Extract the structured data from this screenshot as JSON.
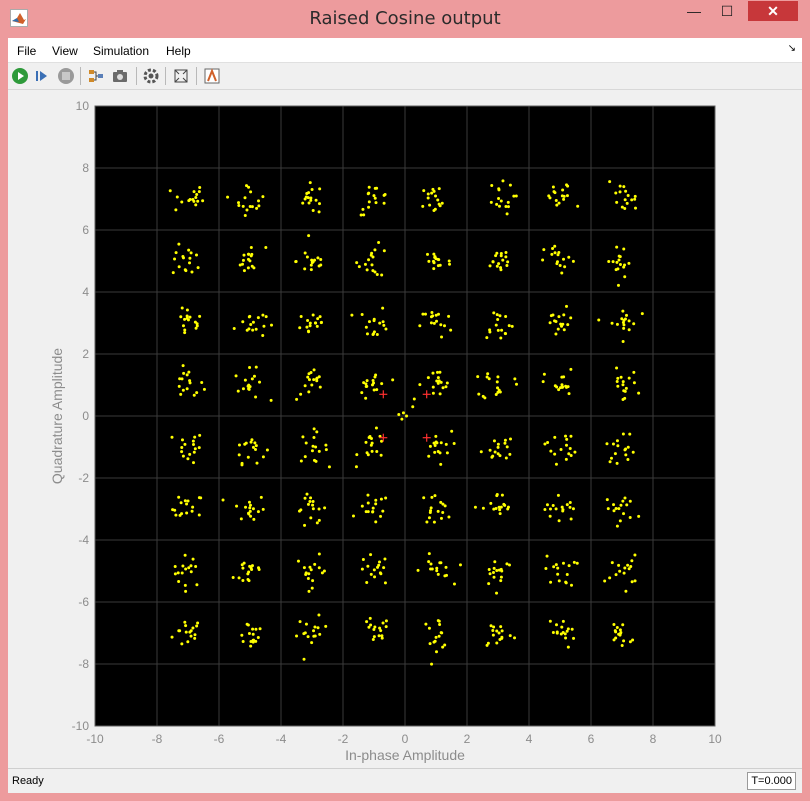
{
  "window": {
    "title": "Raised Cosine output",
    "minimize_glyph": "—",
    "maximize_glyph": "☐",
    "close_glyph": "✕"
  },
  "menu": {
    "items": [
      "File",
      "View",
      "Simulation",
      "Help"
    ],
    "overflow_glyph": "↘"
  },
  "toolbar": {
    "icons": [
      "run-icon",
      "step-forward-icon",
      "stop-icon",
      "signal-selector-icon",
      "snapshot-icon",
      "settings-icon",
      "zoom-fit-icon",
      "highlight-block-icon"
    ]
  },
  "status": {
    "left": "Ready",
    "right": "T=0.000"
  },
  "colors": {
    "plot_background": "#000000",
    "points": "#ffff00",
    "reference_markers": "#ff3030",
    "axis_text": "#8c8c8c",
    "grid": "#3a3a3a"
  },
  "chart_data": {
    "type": "scatter",
    "title": "",
    "xlabel": "In-phase Amplitude",
    "ylabel": "Quadrature Amplitude",
    "xlim": [
      -10,
      10
    ],
    "ylim": [
      -10,
      10
    ],
    "xticks": [
      -10,
      -8,
      -6,
      -4,
      -2,
      0,
      2,
      4,
      6,
      8,
      10
    ],
    "yticks": [
      -10,
      -8,
      -6,
      -4,
      -2,
      0,
      2,
      4,
      6,
      8,
      10
    ],
    "grid": true,
    "series": [
      {
        "marker": "dot",
        "color": "#ffff00",
        "cluster_centers_x": [
          -7,
          -5,
          -3,
          -1,
          1,
          3,
          5,
          7
        ],
        "cluster_centers_y": [
          -7,
          -5,
          -3,
          -1,
          1,
          3,
          5,
          7
        ],
        "cluster_spread": 0.25,
        "points_per_cluster": 16,
        "transient_points": [
          [
            -0.2,
            0.05
          ],
          [
            -0.05,
            0.1
          ],
          [
            0.05,
            0.0
          ],
          [
            0.25,
            0.3
          ],
          [
            0.3,
            0.55
          ],
          [
            -0.1,
            -0.1
          ]
        ]
      },
      {
        "marker": "plus",
        "color": "#ff3030",
        "points": [
          [
            -0.7,
            0.7
          ],
          [
            0.7,
            0.7
          ],
          [
            -0.7,
            -0.7
          ],
          [
            0.7,
            -0.7
          ]
        ]
      }
    ]
  }
}
